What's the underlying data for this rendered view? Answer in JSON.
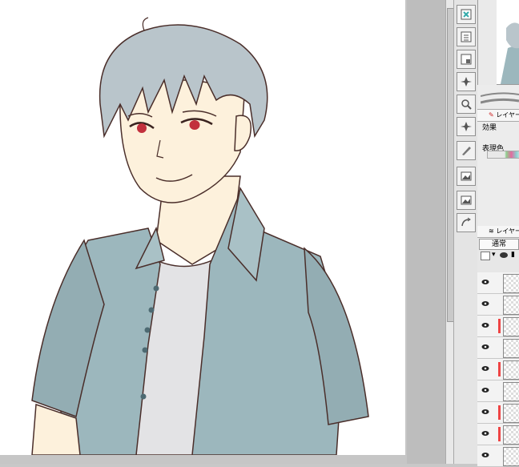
{
  "properties_panel": {
    "tab_label": "レイヤープロパティ",
    "effect_label": "効果",
    "expression_color_label": "表現色"
  },
  "layer_panel": {
    "tab_label": "レイヤー",
    "blend_mode": "通常",
    "rows": [
      {
        "visible": true,
        "has_mark": false
      },
      {
        "visible": true,
        "has_mark": false
      },
      {
        "visible": true,
        "has_mark": true
      },
      {
        "visible": true,
        "has_mark": false
      },
      {
        "visible": true,
        "has_mark": true
      },
      {
        "visible": true,
        "has_mark": false
      },
      {
        "visible": true,
        "has_mark": true
      },
      {
        "visible": true,
        "has_mark": true
      },
      {
        "visible": true,
        "has_mark": false
      }
    ]
  },
  "tools": [
    "sub-view-icon",
    "layer-property-icon",
    "layer-search-icon",
    "auto-action-icon",
    "search-icon",
    "material-icon",
    "brush-size-icon",
    "image-material-icon",
    "image-icon",
    "history-icon"
  ],
  "colors": {
    "shirt": "#9cb7bd",
    "tshirt": "#e3e3e5",
    "skin": "#fdf1dc",
    "hair": "#b9c5cb",
    "eyes": "#c2303d",
    "outline": "#4a2e2a"
  }
}
